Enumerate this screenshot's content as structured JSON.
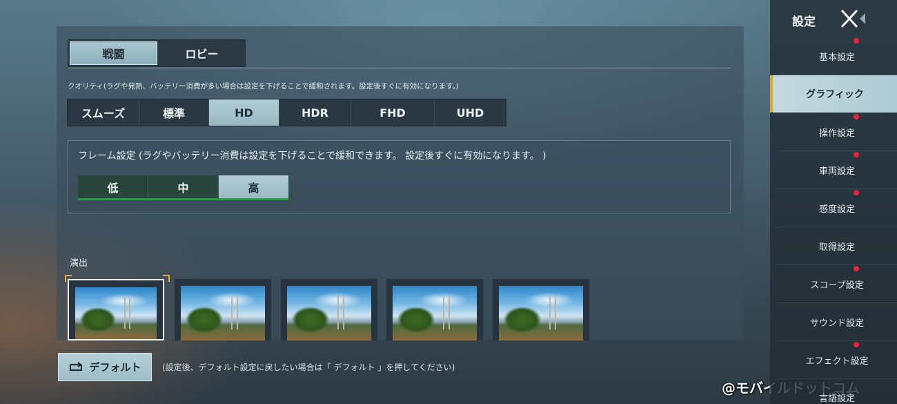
{
  "tabs": [
    {
      "label": "戦闘",
      "active": true
    },
    {
      "label": "ロビー",
      "active": false
    }
  ],
  "quality": {
    "note": "クオリティ(ラグや発熱、バッテリー消費が多い場合は設定を下げることで緩和されます。設定後すぐに有効になります。)",
    "options": [
      "スムーズ",
      "標準",
      "HD",
      "HDR",
      "FHD",
      "UHD"
    ],
    "selected": "HD"
  },
  "frame": {
    "label": "フレーム設定 (ラグやバッテリー消費は設定を下げることで緩和できます。 設定後すぐに有効になります。 )",
    "options": [
      "低",
      "中",
      "高"
    ],
    "selected": "高"
  },
  "effects": {
    "label": "演出",
    "selected_index": 0,
    "count": 5
  },
  "default": {
    "button_label": "デフォルト",
    "note": "(設定後、デフォルト設定に戻したい場合は「 デフォルト 」を押してください)"
  },
  "watermark": "@モバイルドットコム",
  "sidebar": {
    "title": "設定",
    "items": [
      {
        "label": "基本設定",
        "dot": true,
        "active": false
      },
      {
        "label": "グラフィック",
        "dot": false,
        "active": true
      },
      {
        "label": "操作設定",
        "dot": true,
        "active": false
      },
      {
        "label": "車両設定",
        "dot": true,
        "active": false
      },
      {
        "label": "感度設定",
        "dot": true,
        "active": false
      },
      {
        "label": "取得設定",
        "dot": false,
        "active": false
      },
      {
        "label": "スコープ設定",
        "dot": true,
        "active": false
      },
      {
        "label": "サウンド設定",
        "dot": false,
        "active": false
      },
      {
        "label": "エフェクト設定",
        "dot": true,
        "active": false
      },
      {
        "label": "言語設定",
        "dot": false,
        "active": false
      }
    ]
  },
  "colors": {
    "accent": "#e0a728",
    "badge": "#e8243a",
    "selected": "#a9c7d0"
  }
}
